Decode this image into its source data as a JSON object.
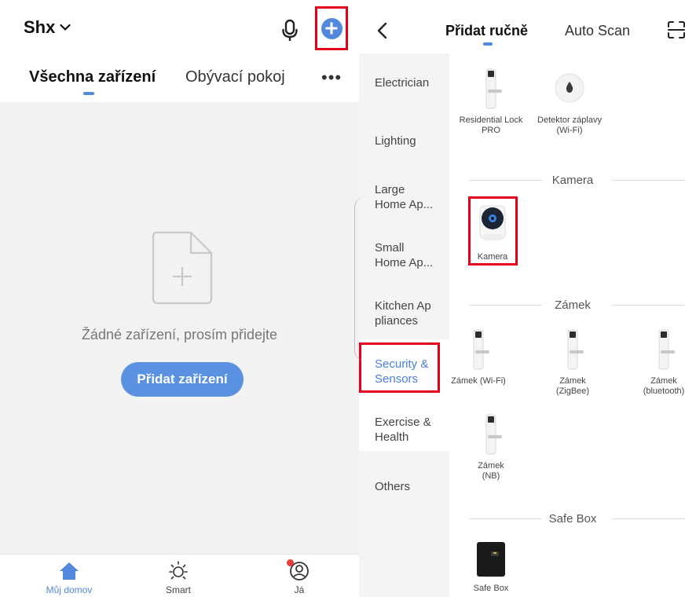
{
  "left": {
    "home_name": "Shx",
    "tabs": [
      "Všechna zařízení",
      "Obývací pokoj"
    ],
    "more": "•••",
    "empty_text": "Žádné zařízení, prosím přidejte",
    "add_button": "Přidat zařízení",
    "nav": [
      {
        "label": "Můj domov",
        "icon": "home-icon",
        "active": true
      },
      {
        "label": "Smart",
        "icon": "sun-icon",
        "active": false
      },
      {
        "label": "Já",
        "icon": "profile-icon",
        "active": false
      }
    ]
  },
  "right": {
    "tabs": [
      "Přidat ručně",
      "Auto Scan"
    ],
    "categories": [
      "Electrician",
      "Lighting",
      "Large Home Ap...",
      "Small Home Ap...",
      "Kitchen Ap pliances",
      "Security & Sensors",
      "Exercise & Health",
      "Others"
    ],
    "active_category": "Security & Sensors",
    "top_devices": [
      "Residential Lock PRO",
      "Detektor záplavy (Wi-Fi)"
    ],
    "sections": [
      {
        "title": "Kamera",
        "devices": [
          "Kamera"
        ]
      },
      {
        "title": "Zámek",
        "devices": [
          "Zámek (Wi-Fi)",
          "Zámek (ZigBee)",
          "Zámek (bluetooth)",
          "Zámek (NB)"
        ]
      },
      {
        "title": "Safe Box",
        "devices": [
          "Safe Box"
        ]
      }
    ]
  },
  "colors": {
    "accent": "#5289dc",
    "highlight": "#e3001b",
    "badge": "#ea3b3b"
  }
}
